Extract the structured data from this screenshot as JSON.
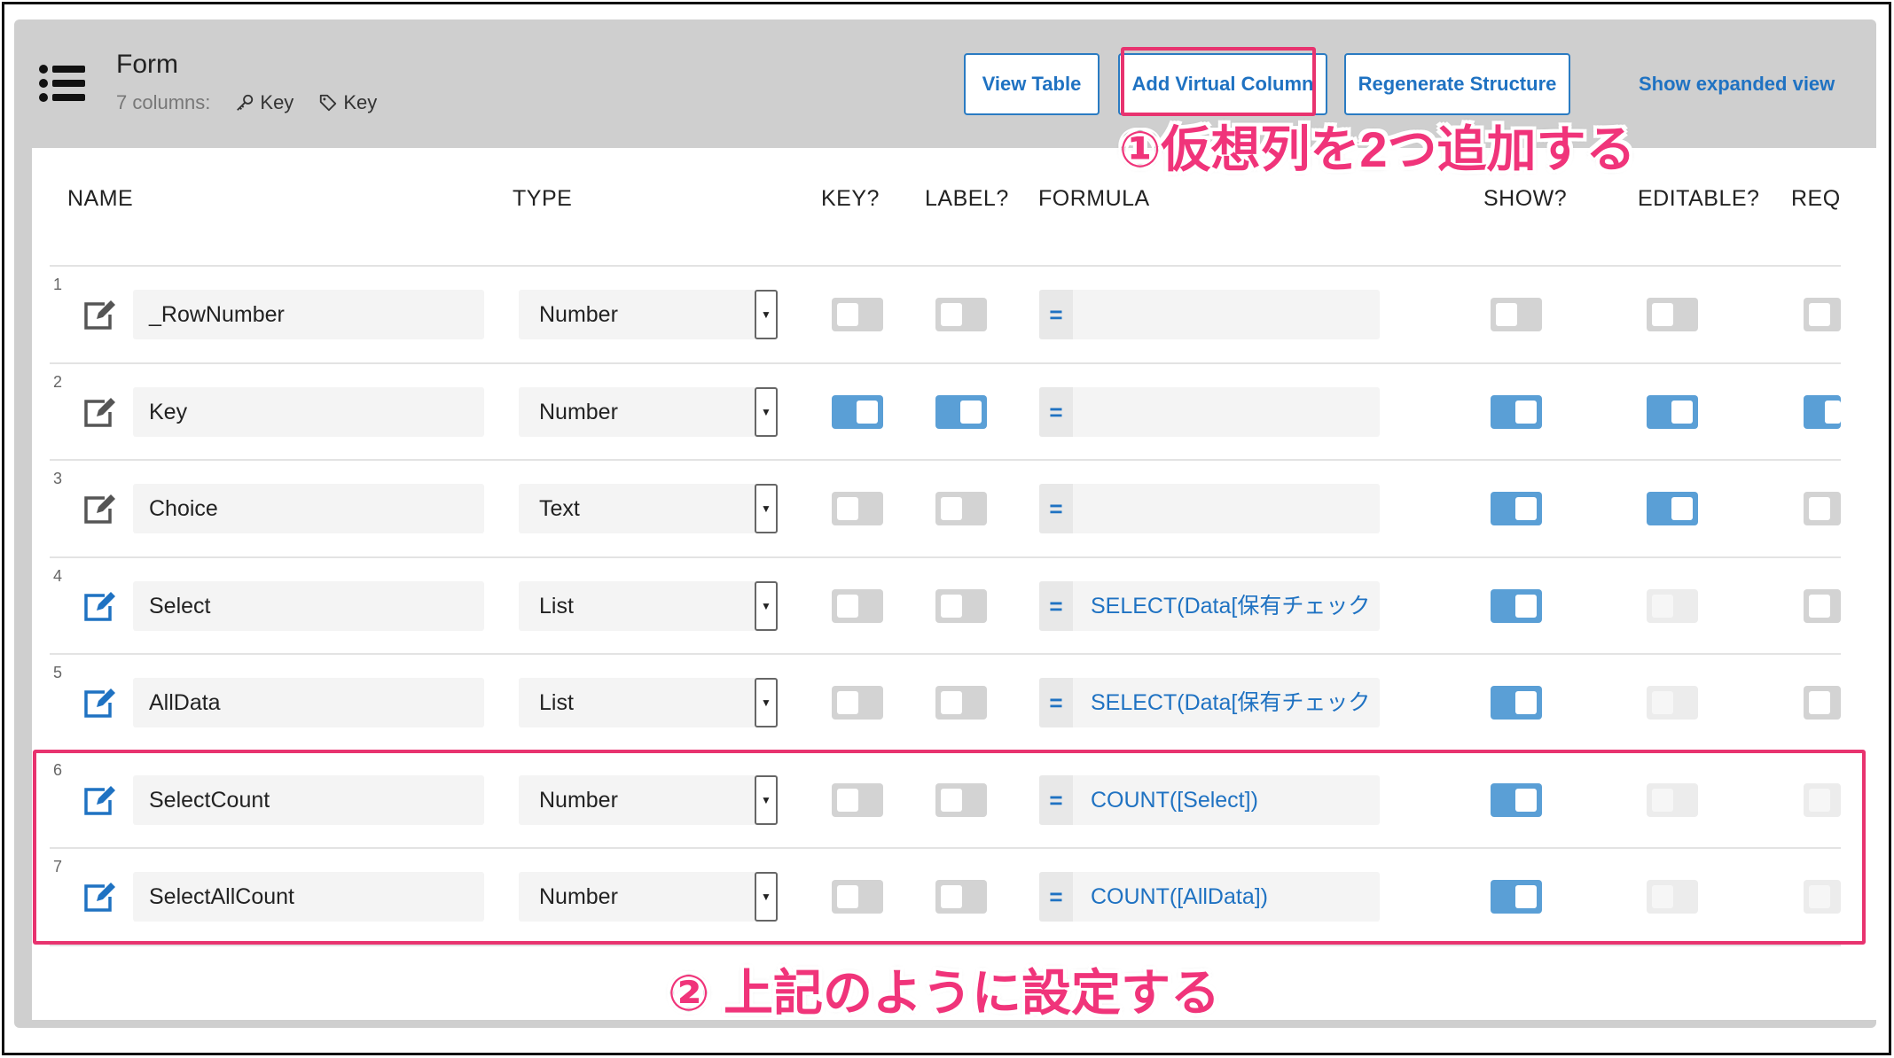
{
  "header": {
    "title": "Form",
    "columns_count": "7 columns:",
    "key_chip": "Key",
    "label_chip": "Key",
    "buttons": {
      "view_table": "View Table",
      "add_virtual_column": "Add Virtual Column",
      "regenerate_structure": "Regenerate Structure"
    },
    "expanded_link": "Show expanded view"
  },
  "table": {
    "headers": {
      "name": "NAME",
      "type": "TYPE",
      "key": "KEY?",
      "label": "LABEL?",
      "formula": "FORMULA",
      "show": "SHOW?",
      "editable": "EDITABLE?",
      "required": "REQU"
    },
    "formula_prefix": "=",
    "rows": [
      {
        "num": "1",
        "name": "_RowNumber",
        "type": "Number",
        "formula": "",
        "key": false,
        "label": false,
        "show": false,
        "editable": false,
        "required": false,
        "editable_dim": false,
        "required_dim": false,
        "icon_color": "#555555"
      },
      {
        "num": "2",
        "name": "Key",
        "type": "Number",
        "formula": "",
        "key": true,
        "label": true,
        "show": true,
        "editable": true,
        "required": true,
        "editable_dim": false,
        "required_dim": false,
        "icon_color": "#555555"
      },
      {
        "num": "3",
        "name": "Choice",
        "type": "Text",
        "formula": "",
        "key": false,
        "label": false,
        "show": true,
        "editable": true,
        "required": false,
        "editable_dim": false,
        "required_dim": false,
        "icon_color": "#555555"
      },
      {
        "num": "4",
        "name": "Select",
        "type": "List",
        "formula": "SELECT(Data[保有チェック",
        "key": false,
        "label": false,
        "show": true,
        "editable": false,
        "required": false,
        "editable_dim": true,
        "required_dim": false,
        "icon_color": "#1f72c2"
      },
      {
        "num": "5",
        "name": "AllData",
        "type": "List",
        "formula": "SELECT(Data[保有チェック",
        "key": false,
        "label": false,
        "show": true,
        "editable": false,
        "required": false,
        "editable_dim": true,
        "required_dim": false,
        "icon_color": "#1f72c2"
      },
      {
        "num": "6",
        "name": "SelectCount",
        "type": "Number",
        "formula": "COUNT([Select])",
        "key": false,
        "label": false,
        "show": true,
        "editable": false,
        "required": false,
        "editable_dim": true,
        "required_dim": true,
        "icon_color": "#1f72c2"
      },
      {
        "num": "7",
        "name": "SelectAllCount",
        "type": "Number",
        "formula": "COUNT([AllData])",
        "key": false,
        "label": false,
        "show": true,
        "editable": false,
        "required": false,
        "editable_dim": true,
        "required_dim": true,
        "icon_color": "#1f72c2"
      }
    ]
  },
  "annotations": {
    "step1": "①仮想列を2つ追加する",
    "step2": "② 上記のように設定する"
  },
  "colors": {
    "accent": "#1f72c2",
    "toggle_on": "#5a9fd6",
    "highlight": "#e8336f"
  }
}
